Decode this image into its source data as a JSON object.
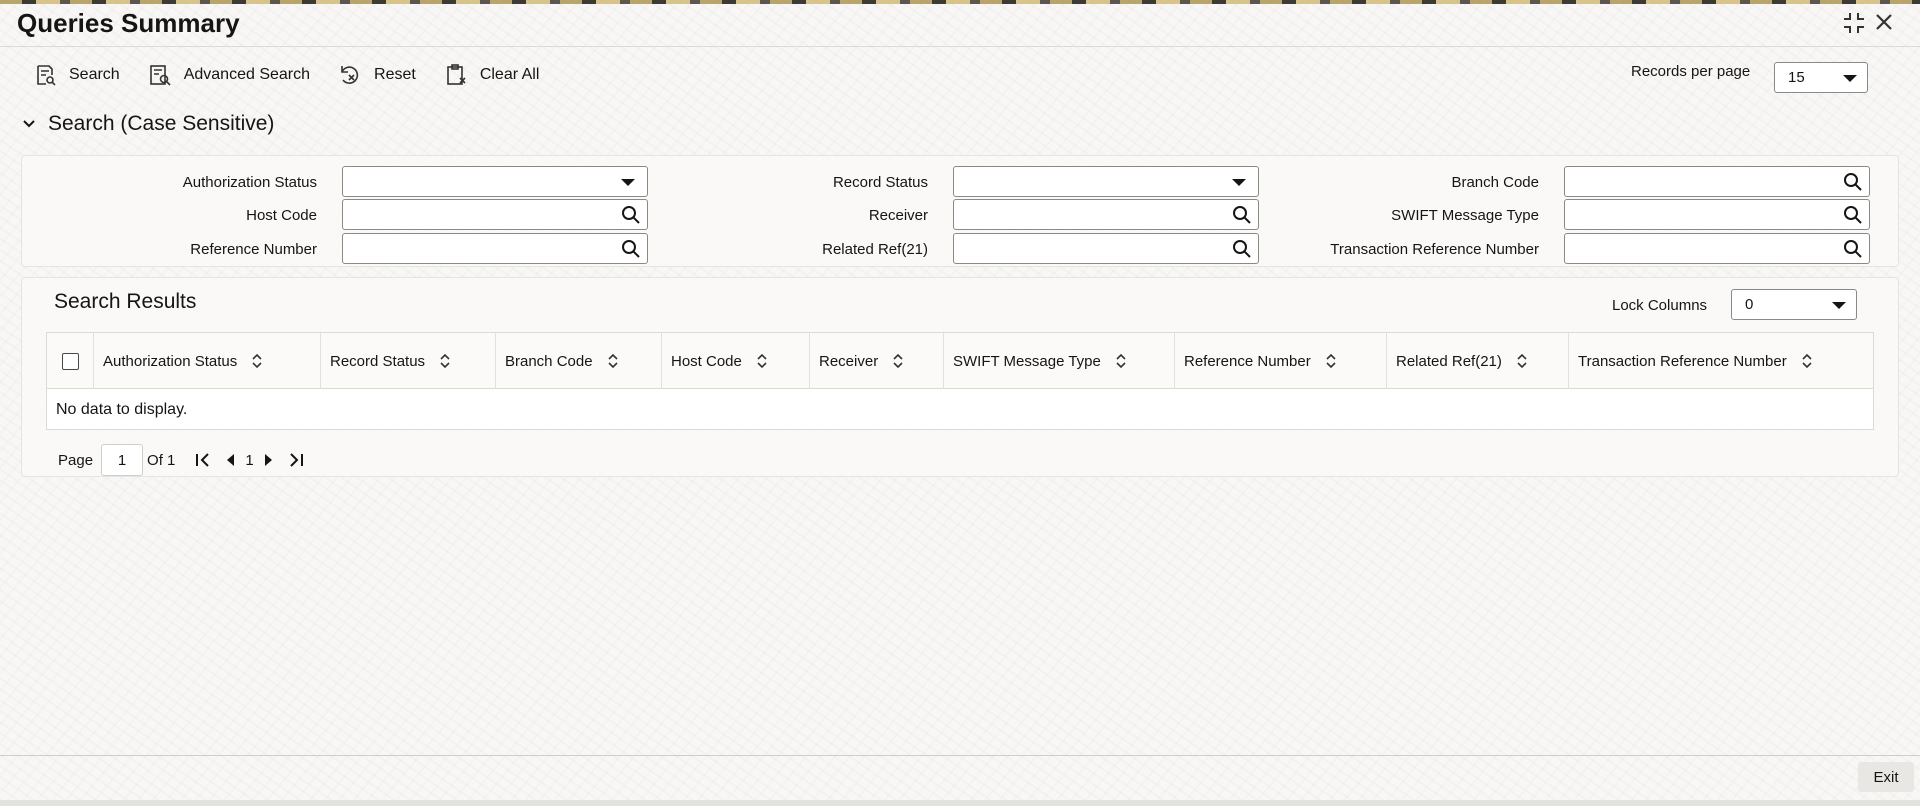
{
  "window": {
    "title": "Queries Summary"
  },
  "toolbar": {
    "search_label": "Search",
    "advanced_search_label": "Advanced Search",
    "reset_label": "Reset",
    "clear_all_label": "Clear All"
  },
  "records_per_page": {
    "label": "Records per page",
    "value": "15"
  },
  "search_section": {
    "heading": "Search (Case Sensitive)",
    "fields": {
      "authorization_status": {
        "label": "Authorization Status",
        "value": ""
      },
      "record_status": {
        "label": "Record Status",
        "value": ""
      },
      "branch_code": {
        "label": "Branch Code",
        "value": ""
      },
      "host_code": {
        "label": "Host Code",
        "value": ""
      },
      "receiver": {
        "label": "Receiver",
        "value": ""
      },
      "swift_message_type": {
        "label": "SWIFT Message Type",
        "value": ""
      },
      "reference_number": {
        "label": "Reference Number",
        "value": ""
      },
      "related_ref": {
        "label": "Related Ref(21)",
        "value": ""
      },
      "transaction_reference_number": {
        "label": "Transaction Reference Number",
        "value": ""
      }
    }
  },
  "results": {
    "heading": "Search Results",
    "lock_columns": {
      "label": "Lock Columns",
      "value": "0"
    },
    "columns": [
      "Authorization Status",
      "Record Status",
      "Branch Code",
      "Host Code",
      "Receiver",
      "SWIFT Message Type",
      "Reference Number",
      "Related Ref(21)",
      "Transaction Reference Number"
    ],
    "empty_message": "No data to display."
  },
  "pagination": {
    "page_label": "Page",
    "current_page": "1",
    "of_label": "Of 1",
    "page_number": "1"
  },
  "footer": {
    "exit_label": "Exit"
  }
}
